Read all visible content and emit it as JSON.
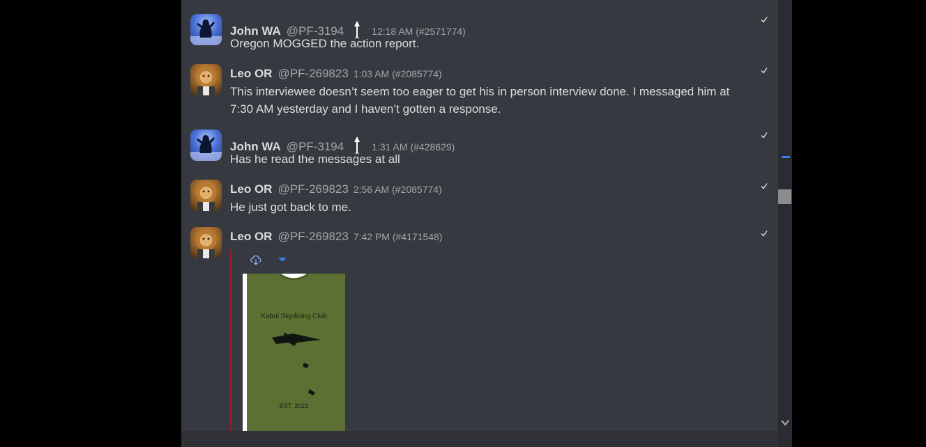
{
  "messages": [
    {
      "name": "John WA",
      "handle": "@PF-3194",
      "time": "12:18 AM (#2571774)",
      "text": "Oregon MOGGED the action report.",
      "avatar": "dark-figure-avatar",
      "has_rank": true
    },
    {
      "name": "Leo OR",
      "handle": "@PF-269823",
      "time": "1:03 AM (#2085774)",
      "text": "This interviewee doesn’t seem too eager to get his in person interview done. I messaged him at 7:30 AM yesterday and I haven’t gotten a response.",
      "avatar": "lion-avatar",
      "has_rank": false
    },
    {
      "name": "John WA",
      "handle": "@PF-3194",
      "time": "1:31 AM (#428629)",
      "text": "Has he read the messages at all",
      "avatar": "dark-figure-avatar",
      "has_rank": true
    },
    {
      "name": "Leo OR",
      "handle": "@PF-269823",
      "time": "2:56 AM (#2085774)",
      "text": "He just got back to me.",
      "avatar": "lion-avatar",
      "has_rank": false
    },
    {
      "name": "Leo OR",
      "handle": "@PF-269823",
      "time": "7:42 PM (#4171548)",
      "text": "",
      "avatar": "lion-avatar",
      "has_rank": false
    }
  ],
  "attachment": {
    "shirt_title": "Kabul Skydiving Club",
    "shirt_footer": "EST. 2021",
    "shirt_color": "#5b7032"
  },
  "colors": {
    "chat_bg": "#36393f",
    "accent": "#3b7cf0",
    "embed_bar": "#8f1d2a"
  }
}
